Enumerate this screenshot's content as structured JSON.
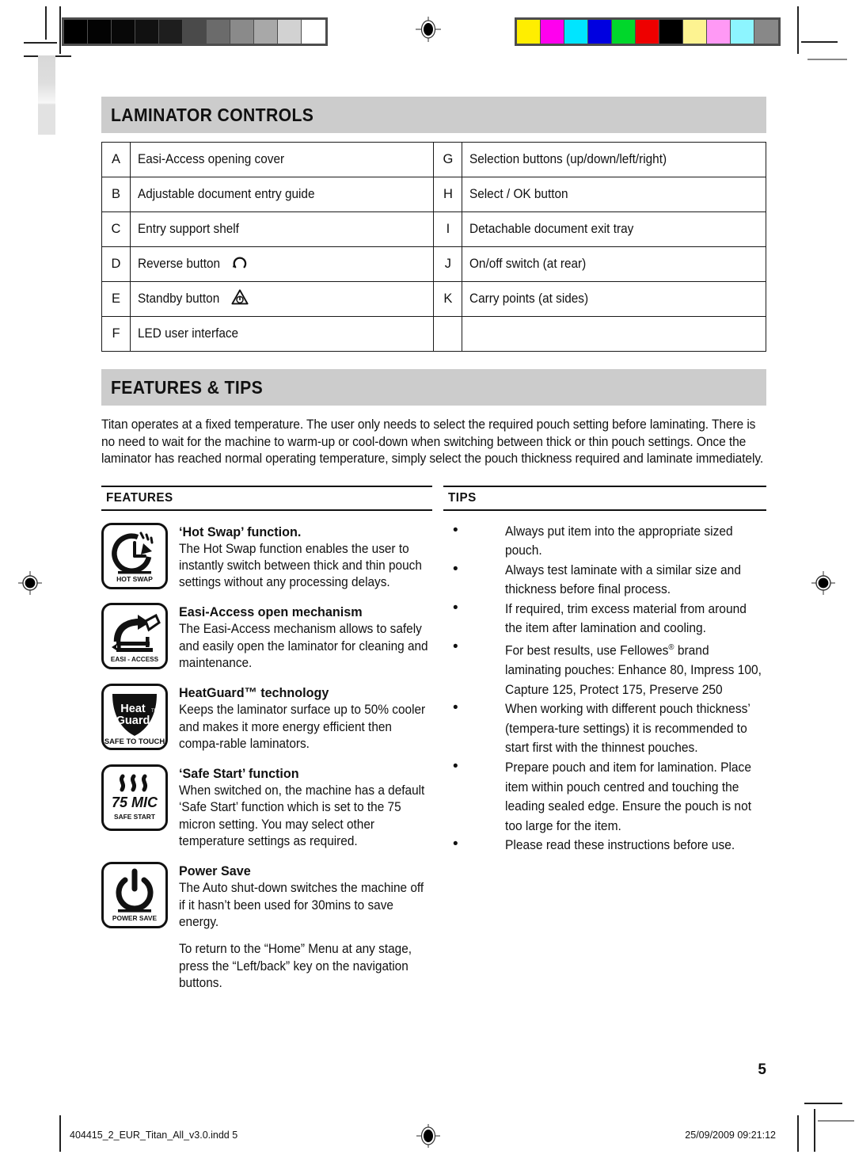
{
  "document": {
    "page_number": "5",
    "footer_file": "404415_2_EUR_Titan_All_v3.0.indd   5",
    "footer_timestamp": "25/09/2009   09:21:12"
  },
  "sections": {
    "laminator_controls": {
      "title": "LAMINATOR CONTROLS",
      "rows": [
        {
          "left_key": "A",
          "left_label": "Easi-Access opening cover",
          "left_icon": "",
          "right_key": "G",
          "right_label": "Selection buttons (up/down/left/right)"
        },
        {
          "left_key": "B",
          "left_label": "Adjustable document entry guide",
          "left_icon": "",
          "right_key": "H",
          "right_label": "Select / OK button"
        },
        {
          "left_key": "C",
          "left_label": "Entry support shelf",
          "left_icon": "",
          "right_key": "I",
          "right_label": "Detachable document exit tray"
        },
        {
          "left_key": "D",
          "left_label": "Reverse button",
          "left_icon": "reverse-icon",
          "right_key": "J",
          "right_label": "On/off switch (at rear)"
        },
        {
          "left_key": "E",
          "left_label": "Standby button",
          "left_icon": "standby-icon",
          "right_key": "K",
          "right_label": "Carry points (at sides)"
        },
        {
          "left_key": "F",
          "left_label": "LED user interface",
          "left_icon": "",
          "right_key": "",
          "right_label": ""
        }
      ]
    },
    "features_and_tips": {
      "title": "FEATURES & TIPS",
      "intro": "Titan operates at a fixed temperature. The user only needs to select the required pouch setting before laminating. There is no need to wait for the machine to warm-up or cool-down when switching between thick or thin pouch settings. Once the laminator has reached normal operating temperature, simply select the pouch thickness required and laminate immediately.",
      "features_column_title": "FEATURES",
      "tips_column_title": "TIPS",
      "features": [
        {
          "icon": "hot-swap-icon",
          "icon_caption": "HOT SWAP",
          "title": "‘Hot Swap’ function.",
          "body": "The Hot Swap function enables the user to instantly switch between thick and thin pouch settings without any processing delays."
        },
        {
          "icon": "easi-access-icon",
          "icon_caption": "EASI - ACCESS",
          "title": "Easi-Access open mechanism",
          "body": "The Easi-Access mechanism allows to safely and easily open the laminator for cleaning and maintenance."
        },
        {
          "icon": "heat-guard-icon",
          "icon_caption": "SAFE TO TOUCH",
          "icon_text_1": "Heat",
          "icon_text_2": "Guard",
          "title": "HeatGuard™ technology",
          "body": "Keeps the laminator surface up to 50% cooler and makes it more energy efficient then compa-rable laminators."
        },
        {
          "icon": "safe-start-icon",
          "icon_caption": "SAFE START",
          "icon_text_1": "75 MIC",
          "title": "‘Safe Start’ function",
          "body": "When switched on, the machine has a default ‘Safe Start’ function which is set to the 75 micron setting. You may select other temperature settings as required."
        },
        {
          "icon": "power-save-icon",
          "icon_caption": "POWER SAVE",
          "title": "Power Save",
          "body": "The Auto shut-down switches the machine off if it hasn’t been used for 30mins to save energy.",
          "body2": "To return to the “Home” Menu at any stage, press the “Left/back” key on the navigation buttons."
        }
      ],
      "tips": [
        "Always put item into the appropriate sized pouch.",
        "Always test laminate with a similar size and thickness before final process.",
        "If required, trim excess material from around the item after lamination and cooling.",
        "For best results, use Fellowes® brand laminating pouches: Enhance 80, Impress 100, Capture 125, Protect 175, Preserve 250",
        "When working with different pouch thickness’ (tempera-ture settings) it is recommended to start first with the thinnest pouches.",
        "Prepare pouch and item for lamination. Place item within pouch centred and touching the leading sealed edge. Ensure the pouch is not too large for the item.",
        "Please read these instructions before use."
      ]
    }
  },
  "print_marks": {
    "grayscale_patches": [
      "#000000",
      "#030303",
      "#080808",
      "#111111",
      "#1e1e1e",
      "#4a4a4a",
      "#6b6b6b",
      "#8a8a8a",
      "#a8a8a8",
      "#d2d2d2",
      "#ffffff"
    ],
    "color_patches": [
      "#ffee00",
      "#ff00ee",
      "#00e5ff",
      "#0000e0",
      "#00d72b",
      "#ee0000",
      "#000000",
      "#fdf391",
      "#ff99f5",
      "#8df5ff",
      "#888888"
    ]
  }
}
